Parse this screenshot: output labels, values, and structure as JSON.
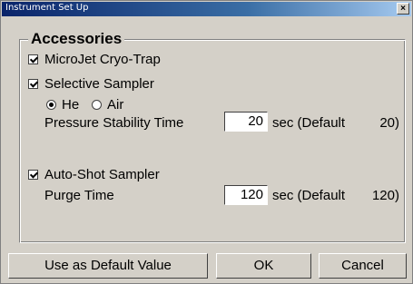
{
  "window": {
    "title": "Instrument Set Up",
    "close_label": "×"
  },
  "group": {
    "title": "Accessories"
  },
  "microjet": {
    "label": "MicroJet Cryo-Trap",
    "checked": true
  },
  "selective": {
    "label": "Selective Sampler",
    "checked": true,
    "gas_options": [
      {
        "label": "He",
        "selected": true
      },
      {
        "label": "Air",
        "selected": false
      }
    ],
    "pressure_label": "Pressure Stability Time",
    "pressure_value": "20",
    "pressure_unit": "sec (Default",
    "pressure_default": "20)"
  },
  "autoshot": {
    "label": "Auto-Shot Sampler",
    "checked": true,
    "purge_label": "Purge Time",
    "purge_value": "120",
    "purge_unit": "sec (Default",
    "purge_default": "120)"
  },
  "buttons": {
    "default": "Use as Default Value",
    "ok": "OK",
    "cancel": "Cancel"
  }
}
